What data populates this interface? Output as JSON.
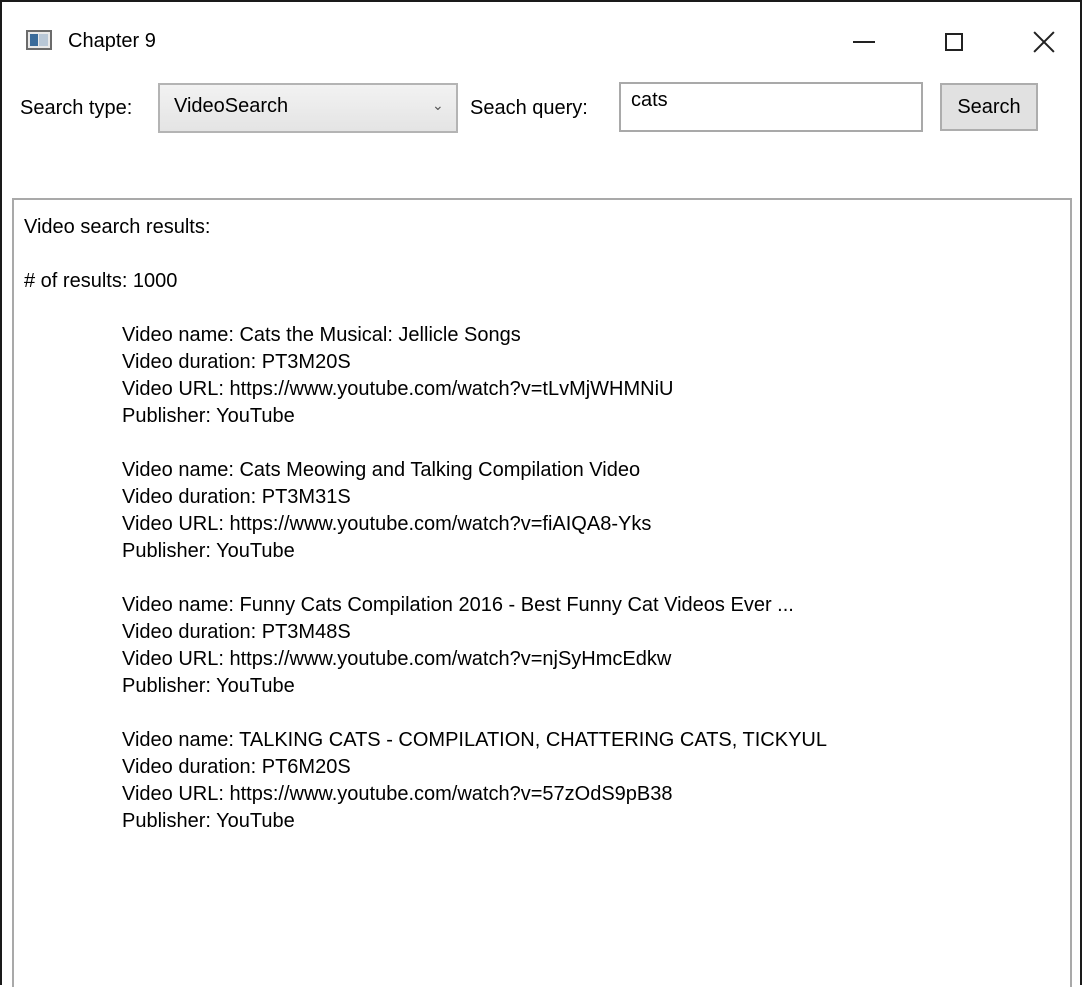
{
  "window": {
    "title": "Chapter 9",
    "controls": {
      "minimize": "minimize",
      "maximize": "maximize",
      "close": "close"
    }
  },
  "toolbar": {
    "search_type_label": "Search type:",
    "search_type_value": "VideoSearch",
    "query_label": "Seach query:",
    "query_value": "cats",
    "search_button": "Search"
  },
  "results": {
    "header": "Video search results:",
    "count_line": "# of results: 1000",
    "videos": [
      {
        "name": "Video name: Cats the Musical: Jellicle Songs",
        "duration": "Video duration: PT3M20S",
        "url": "Video URL: https://www.youtube.com/watch?v=tLvMjWHMNiU",
        "publisher": "Publisher: YouTube"
      },
      {
        "name": "Video name: Cats Meowing and Talking Compilation Video",
        "duration": "Video duration: PT3M31S",
        "url": "Video URL: https://www.youtube.com/watch?v=fiAIQA8-Yks",
        "publisher": "Publisher: YouTube"
      },
      {
        "name": "Video name: Funny Cats Compilation 2016 - Best Funny Cat Videos Ever ...",
        "duration": "Video duration: PT3M48S",
        "url": "Video URL: https://www.youtube.com/watch?v=njSyHmcEdkw",
        "publisher": "Publisher: YouTube"
      },
      {
        "name": "Video name: TALKING CATS - COMPILATION, CHATTERING CATS, TICKYUL",
        "duration": "Video duration: PT6M20S",
        "url": "Video URL: https://www.youtube.com/watch?v=57zOdS9pB38",
        "publisher": "Publisher: YouTube"
      }
    ]
  }
}
